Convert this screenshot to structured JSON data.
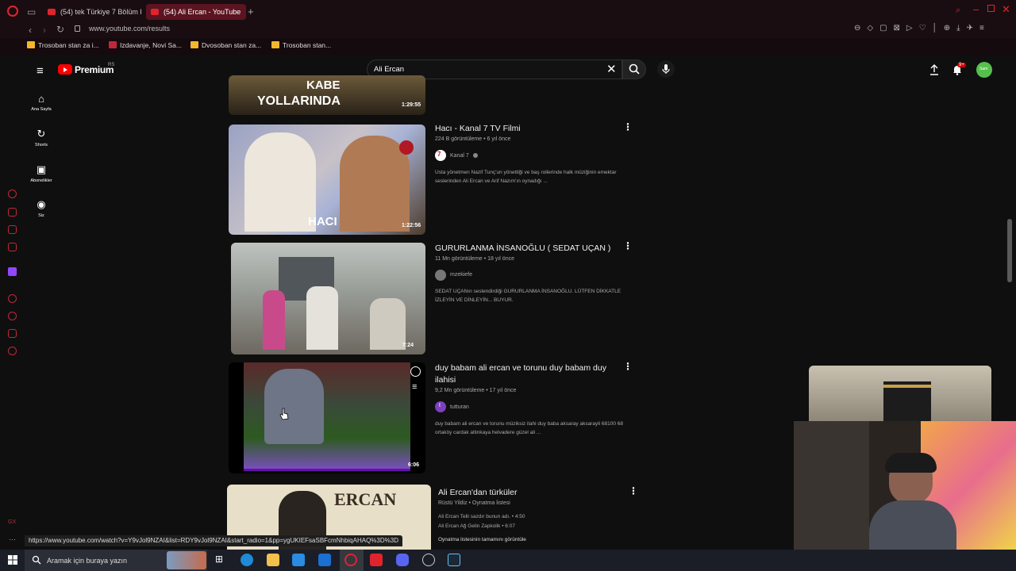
{
  "browser": {
    "tabs": [
      {
        "label": "(54) tek Türkiye 7 Bölüm F",
        "active": false
      },
      {
        "label": "(54) Ali Ercan - YouTube",
        "active": true
      }
    ],
    "url": "www.youtube.com/results",
    "bookmarks": [
      "Trosoban stan za i...",
      "Izdavanje, Novi Sa...",
      "Dvosoban stan za...",
      "Trosoban stan..."
    ],
    "status_url": "https://www.youtube.com/watch?v=Y9vJol9NZAI&list=RDY9vJol9NZAI&start_radio=1&pp=ygUKIEFsaSBFcmNhbiqAHAQ%3D%3D"
  },
  "youtube": {
    "brand": "Premium",
    "region": "RS",
    "search_value": "Ali Ercan",
    "notifications": "9+",
    "avatar_text": "Sam",
    "guide": [
      {
        "label": "Ana Sayfa",
        "icon": "home-icon"
      },
      {
        "label": "Shorts",
        "icon": "shorts-icon"
      },
      {
        "label": "Abonelikler",
        "icon": "subscriptions-icon"
      },
      {
        "label": "Siz",
        "icon": "you-icon"
      }
    ]
  },
  "results": {
    "partial": {
      "thumb_text_1": "KABE",
      "thumb_text_2": "YOLLARINDA",
      "duration": "1:29:55"
    },
    "items": [
      {
        "title": "Hacı - Kanal 7 TV Filmi",
        "meta": "224 B görüntüleme • 6 yıl önce",
        "channel": "Kanal 7",
        "description": "Usta yönetmen Nazif Tunç'un yönettiği ve baş rollerinde halk müziğinin emektar seslerinden Ali Ercan ve Arif Nazım'ın oynadığı ...",
        "duration": "1:22:56",
        "thumb_text": "HACI"
      },
      {
        "title": "GURURLANMA İNSANOĞLU ( SEDAT UÇAN )",
        "meta": "11 Mn görüntüleme • 18 yıl önce",
        "channel": "mzekiefe",
        "description": "SEDAT UÇANın seslendirdiği GURURLANMA İNSANOĞLU. LÜTFEN DİKKATLE İZLEYİN VE DİNLEYİN... BUYUR.",
        "duration": "7:24"
      },
      {
        "title": "duy babam ali ercan ve torunu duy babam duy ilahisi",
        "meta": "9,2 Mn görüntüleme • 17 yıl önce",
        "channel": "tutturan",
        "channel_initial": "t",
        "description": "duy babam ali ercan ve torunu müziksiz ilahi duy baba aksaray aksarayli 68100 68 ortaköy cardak altinkaya helvadere güzel ali ...",
        "duration": "6:06"
      },
      {
        "title": "Ali Ercan'dan türküler",
        "meta": "Rüstü Yildiz • Oynatma listesi",
        "thumb_text": "ERCAN",
        "playlist": [
          "Ali Ercan Telli sazdır bunun adı. • 4:50",
          "Ali Ercan Ağ Gelin Zapkolik • 6:07"
        ],
        "view_full": "Oynatma listesinin tamamını görüntüle"
      }
    ]
  },
  "taskbar": {
    "search_placeholder": "Aramak için buraya yazın"
  }
}
